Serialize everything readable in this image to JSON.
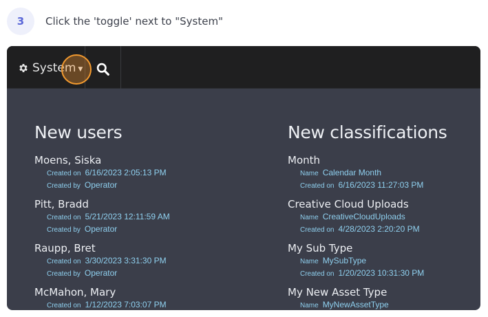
{
  "step": {
    "number": "3",
    "instruction": "Click the 'toggle' next to \"System\""
  },
  "navbar": {
    "system_label": "System",
    "icons": [
      "gear-icon",
      "caret-down-icon",
      "search-icon"
    ],
    "highlight_color": "#f39a2f"
  },
  "new_users": {
    "title": "New users",
    "items": [
      {
        "name": "Moens, Siska",
        "created_on_label": "Created on",
        "created_on": "6/16/2023 2:05:13 PM",
        "created_by_label": "Created by",
        "created_by": "Operator"
      },
      {
        "name": "Pitt, Bradd",
        "created_on_label": "Created on",
        "created_on": "5/21/2023 12:11:59 AM",
        "created_by_label": "Created by",
        "created_by": "Operator"
      },
      {
        "name": "Raupp, Bret",
        "created_on_label": "Created on",
        "created_on": "3/30/2023 3:31:30 PM",
        "created_by_label": "Created by",
        "created_by": "Operator"
      },
      {
        "name": "McMahon, Mary",
        "created_on_label": "Created on",
        "created_on": "1/12/2023 7:03:07 PM"
      }
    ]
  },
  "new_classifications": {
    "title": "New classifications",
    "items": [
      {
        "name": "Month",
        "name_label": "Name",
        "value": "Calendar Month",
        "created_on_label": "Created on",
        "created_on": "6/16/2023 11:27:03 PM"
      },
      {
        "name": "Creative Cloud Uploads",
        "name_label": "Name",
        "value": "CreativeCloudUploads",
        "created_on_label": "Created on",
        "created_on": "4/28/2023 2:20:20 PM"
      },
      {
        "name": "My Sub Type",
        "name_label": "Name",
        "value": "MySubType",
        "created_on_label": "Created on",
        "created_on": "1/20/2023 10:31:30 PM"
      },
      {
        "name": "My New Asset Type",
        "name_label": "Name",
        "value": "MyNewAssetType"
      }
    ]
  }
}
